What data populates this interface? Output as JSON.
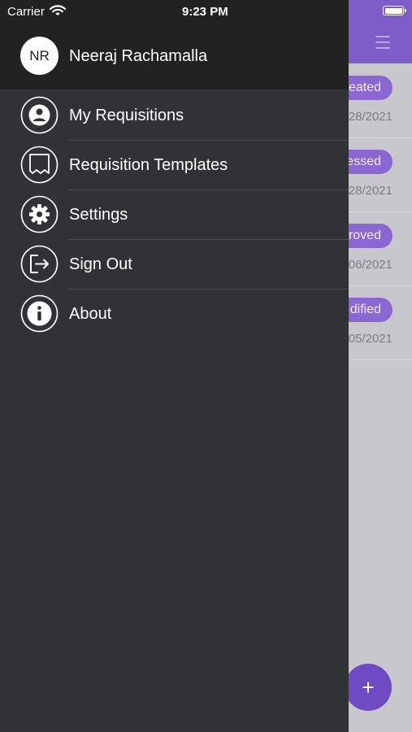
{
  "status_bar": {
    "carrier": "Carrier",
    "time": "9:23 PM"
  },
  "user": {
    "initials": "NR",
    "name": "Neeraj Rachamalla"
  },
  "menu": {
    "items": [
      {
        "label": "My Requisitions",
        "icon": "user-circle-icon"
      },
      {
        "label": "Requisition Templates",
        "icon": "template-icon"
      },
      {
        "label": "Settings",
        "icon": "gear-icon"
      },
      {
        "label": "Sign Out",
        "icon": "sign-out-icon"
      },
      {
        "label": "About",
        "icon": "info-icon"
      }
    ]
  },
  "background_list": {
    "rows": [
      {
        "status": "eated",
        "date": "28/2021"
      },
      {
        "status": "essed",
        "date": "28/2021"
      },
      {
        "status": "roved",
        "date": "06/2021"
      },
      {
        "status": "dified",
        "date": "05/2021"
      }
    ],
    "fab_label": "+"
  },
  "colors": {
    "drawer": "#313236",
    "drawer_header": "#222223",
    "accent": "#7d5cc7",
    "badge": "#8b67d1"
  }
}
